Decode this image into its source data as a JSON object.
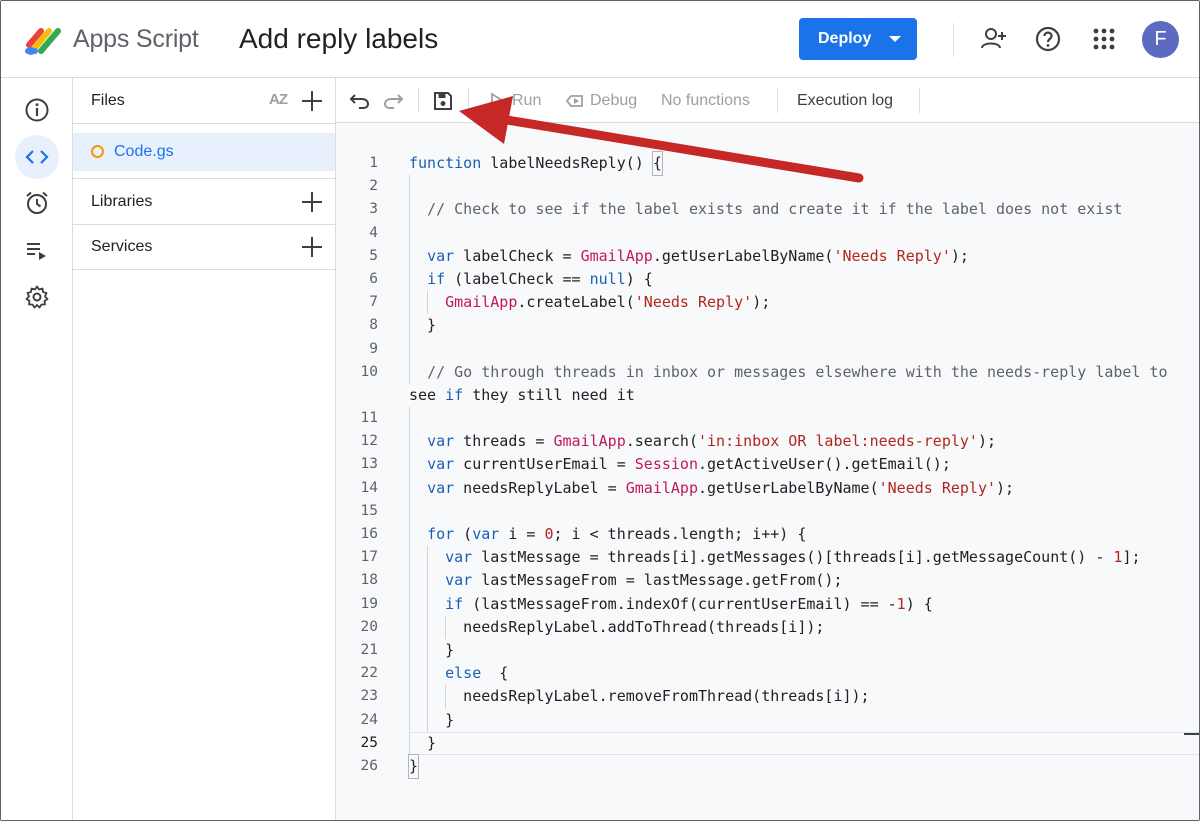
{
  "header": {
    "app_name": "Apps Script",
    "project_title": "Add reply labels",
    "deploy_label": "Deploy",
    "avatar_initial": "F"
  },
  "rail": {
    "items": [
      "info-icon",
      "code-icon",
      "alarm-clock-icon",
      "executions-icon",
      "settings-icon"
    ],
    "active": "code-icon"
  },
  "files_panel": {
    "title": "Files",
    "sort_label": "AZ",
    "files": [
      {
        "name": "Code.gs"
      }
    ],
    "libraries_label": "Libraries",
    "services_label": "Services"
  },
  "toolbar": {
    "run_label": "Run",
    "debug_label": "Debug",
    "function_select": "No functions",
    "execution_log_label": "Execution log"
  },
  "editor": {
    "current_line": 25,
    "lines": [
      {
        "n": "1",
        "text": "function labelNeedsReply() {"
      },
      {
        "n": "2",
        "text": ""
      },
      {
        "n": "3",
        "text": "  // Check to see if the label exists and create it if the label does not exist"
      },
      {
        "n": "4",
        "text": ""
      },
      {
        "n": "5",
        "text": "  var labelCheck = GmailApp.getUserLabelByName('Needs Reply');"
      },
      {
        "n": "6",
        "text": "  if (labelCheck == null) {"
      },
      {
        "n": "7",
        "text": "    GmailApp.createLabel('Needs Reply');"
      },
      {
        "n": "8",
        "text": "  }"
      },
      {
        "n": "9",
        "text": ""
      },
      {
        "n": "10",
        "text": "  // Go through threads in inbox or messages elsewhere with the needs-reply label to"
      },
      {
        "n": "",
        "text": "see if they still need it"
      },
      {
        "n": "11",
        "text": ""
      },
      {
        "n": "12",
        "text": "  var threads = GmailApp.search('in:inbox OR label:needs-reply');"
      },
      {
        "n": "13",
        "text": "  var currentUserEmail = Session.getActiveUser().getEmail();"
      },
      {
        "n": "14",
        "text": "  var needsReplyLabel = GmailApp.getUserLabelByName('Needs Reply');"
      },
      {
        "n": "15",
        "text": ""
      },
      {
        "n": "16",
        "text": "  for (var i = 0; i < threads.length; i++) {"
      },
      {
        "n": "17",
        "text": "    var lastMessage = threads[i].getMessages()[threads[i].getMessageCount() - 1];"
      },
      {
        "n": "18",
        "text": "    var lastMessageFrom = lastMessage.getFrom();"
      },
      {
        "n": "19",
        "text": "    if (lastMessageFrom.indexOf(currentUserEmail) == -1) {"
      },
      {
        "n": "20",
        "text": "      needsReplyLabel.addToThread(threads[i]);"
      },
      {
        "n": "21",
        "text": "    }"
      },
      {
        "n": "22",
        "text": "    else  {"
      },
      {
        "n": "23",
        "text": "      needsReplyLabel.removeFromThread(threads[i]);"
      },
      {
        "n": "24",
        "text": "    }"
      },
      {
        "n": "25",
        "text": "  }"
      },
      {
        "n": "26",
        "text": "}"
      }
    ]
  },
  "colors": {
    "accent": "#1a73e8",
    "annotation_arrow": "#c62828"
  }
}
